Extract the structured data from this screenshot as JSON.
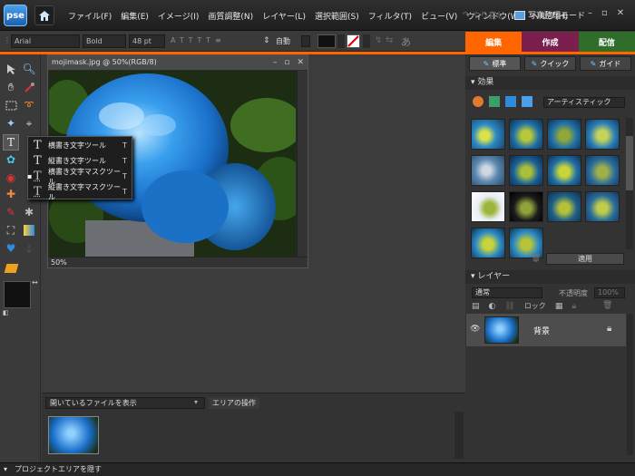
{
  "app": {
    "logo": "pse"
  },
  "menu": [
    "ファイル(F)",
    "編集(E)",
    "イメージ(I)",
    "画質調整(N)",
    "レイヤー(L)",
    "選択範囲(S)",
    "フィルタ(T)",
    "ビュー(V)",
    "ウィンドウ(W)",
    "ヘルプ(H)"
  ],
  "titlebar": {
    "redo_label": "やり直し",
    "organizer_label": "写真整理モード"
  },
  "options": {
    "font_family": "Arial",
    "font_style": "Bold",
    "font_size": "48 pt",
    "leading": "自動",
    "aa_glyph": "あ"
  },
  "mode_tabs": [
    {
      "label": "編集",
      "color": "#ff6600"
    },
    {
      "label": "作成",
      "color": "#7a1f4e"
    },
    {
      "label": "配信",
      "color": "#2f6d2a"
    }
  ],
  "document": {
    "title": "mojimask.jpg @ 50%(RGB/8)",
    "zoom": "50%"
  },
  "flyout": [
    {
      "label": "横書き文字ツール",
      "key": "T",
      "selected": false
    },
    {
      "label": "縦書き文字ツール",
      "key": "T",
      "selected": false
    },
    {
      "label": "横書き文字マスクツール",
      "key": "T",
      "selected": true
    },
    {
      "label": "縦書き文字マスクツール",
      "key": "T",
      "selected": false
    }
  ],
  "panel_tabs": [
    "標準",
    "クイック",
    "ガイド"
  ],
  "effects": {
    "title": "効果",
    "category": "アーティスティック",
    "apply_label": "適用"
  },
  "layers": {
    "title": "レイヤー",
    "blend_mode": "通常",
    "opacity_label": "不透明度",
    "opacity_value": "100%",
    "lock_label": "ロック",
    "layer_name": "背景"
  },
  "project_bin": {
    "dropdown": "開いているファイルを表示",
    "area_ops": "エリアの操作"
  },
  "statusbar": {
    "hide_project": "プロジェクトエリアを隠す"
  }
}
